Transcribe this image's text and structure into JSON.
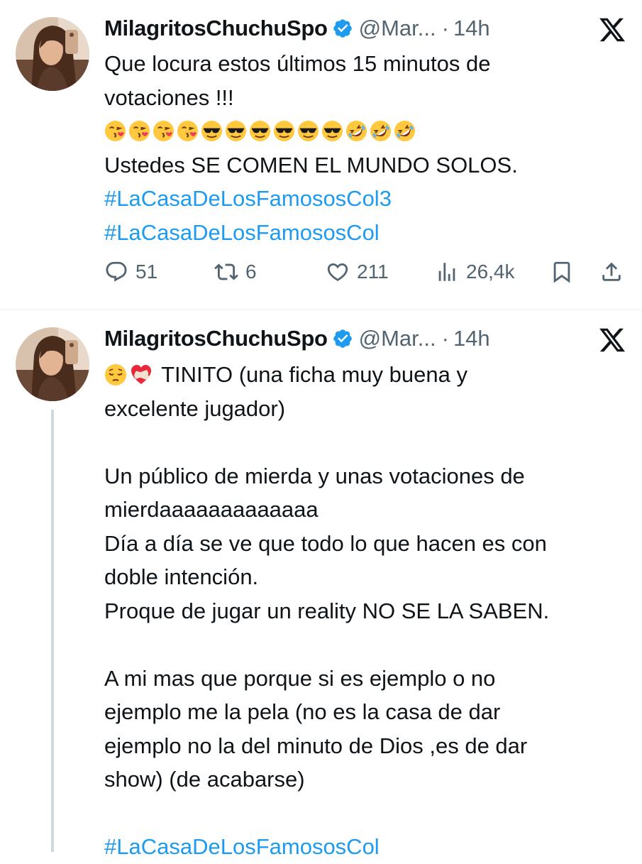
{
  "tweets": [
    {
      "author_name": "MilagritosChuchuSpo",
      "handle": "@Mar...",
      "separator": "·",
      "time": "14h",
      "lines": [
        "Que locura estos últimos 15 minutos de",
        "votaciones !!!"
      ],
      "emojis": [
        "kissing-heart",
        "kissing-heart",
        "kissing-heart",
        "kissing-heart",
        "sunglasses",
        "sunglasses",
        "sunglasses",
        "sunglasses",
        "sunglasses",
        "sunglasses",
        "rofl",
        "rofl",
        "rofl"
      ],
      "after_emoji": "Ustedes SE COMEN EL MUNDO SOLOS.",
      "hashtags": [
        "#LaCasaDeLosFamososCol3",
        "#LaCasaDeLosFamososCol"
      ],
      "metrics": {
        "replies": "51",
        "reposts": "6",
        "likes": "211",
        "views": "26,4k"
      }
    },
    {
      "author_name": "MilagritosChuchuSpo",
      "handle": "@Mar...",
      "separator": "·",
      "time": "14h",
      "first_line_emojis": [
        "pensive",
        "mending-heart"
      ],
      "first_line_text": "TINITO (una ficha muy buena y",
      "lines_a": [
        "excelente jugador)"
      ],
      "lines_b": [
        "Un público de mierda y unas votaciones de",
        "mierdaaaaaaaaaaaaa",
        "Día a día se ve que todo lo que hacen es con",
        "doble intención.",
        "Proque de jugar un reality NO SE LA SABEN."
      ],
      "lines_c": [
        "A mi mas que porque si es ejemplo o no",
        "ejemplo me la pela (no es la casa de dar",
        "ejemplo no la del minuto de Dios ,es de dar",
        "show) (de acabarse)"
      ],
      "hashtag": "#LaCasaDeLosFamososCol"
    }
  ],
  "icons": {
    "verified": "verified-badge-icon",
    "platform": "x-logo-icon",
    "reply": "reply-icon",
    "repost": "repost-icon",
    "like": "like-icon",
    "views": "views-icon",
    "bookmark": "bookmark-icon",
    "share": "share-icon"
  },
  "colors": {
    "text": "#0f1419",
    "secondary": "#536471",
    "link": "#1d9bf0",
    "verified": "#1d9bf0",
    "divider": "#eff3f4",
    "thread": "#cfd9de"
  }
}
